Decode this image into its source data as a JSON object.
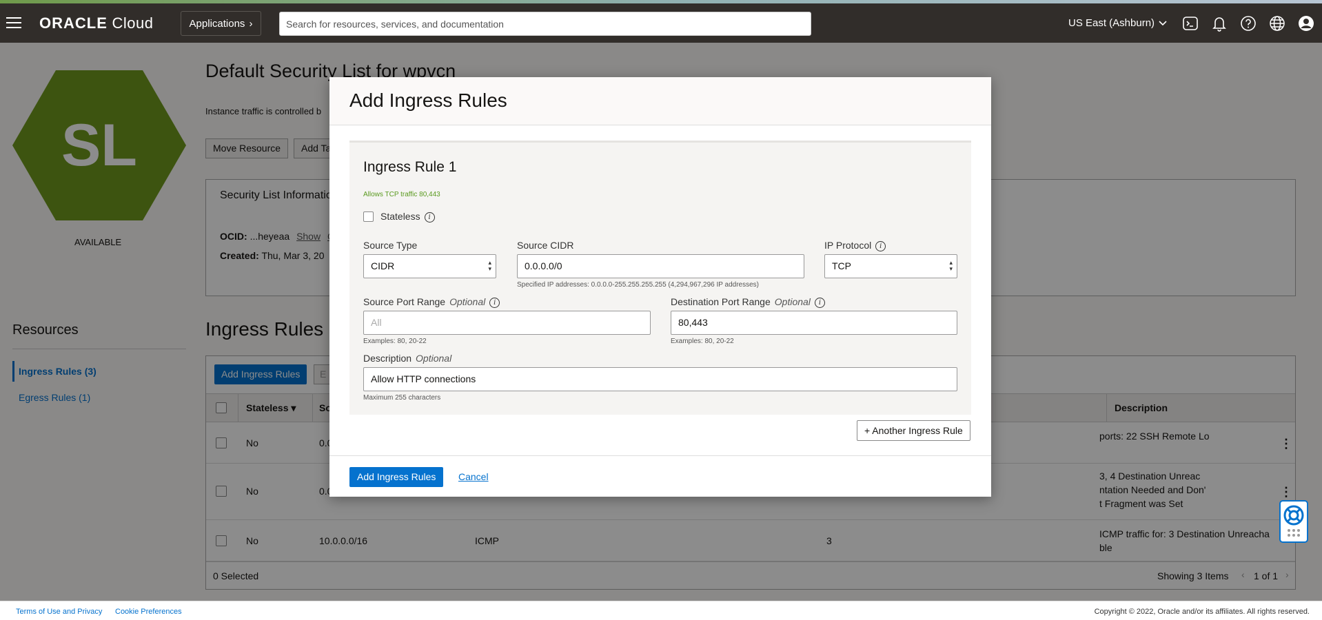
{
  "header": {
    "brand_bold": "ORACLE",
    "brand_rest": " Cloud",
    "applications_label": "Applications",
    "search_placeholder": "Search for resources, services, and documentation",
    "region": "US East (Ashburn)"
  },
  "left_panel": {
    "badge_text": "SL",
    "status": "AVAILABLE",
    "resources_heading": "Resources",
    "items": [
      {
        "label": "Ingress Rules (3)"
      },
      {
        "label": "Egress Rules (1)"
      }
    ]
  },
  "page": {
    "title": "Default Security List for wpvcn",
    "subtitle": "Instance traffic is controlled b",
    "buttons": {
      "move": "Move Resource",
      "add_tags": "Add Ta"
    },
    "info": {
      "title": "Security List Informatio",
      "ocid_label": "OCID:",
      "ocid_value": "...heyeaa",
      "show": "Show",
      "copy": "C",
      "created_label": "Created:",
      "created_value": "Thu, Mar 3, 20"
    },
    "ingress_heading": "Ingress Rules",
    "table": {
      "add_button": "Add Ingress Rules",
      "edit_button": "E",
      "columns": {
        "stateless": "Stateless",
        "source": "So",
        "description": "Description"
      },
      "rows": [
        {
          "stateless": "No",
          "source": "0.0",
          "protocol": "",
          "type": "",
          "description": "ports: 22 SSH Remote Lo"
        },
        {
          "stateless": "No",
          "source": "0.0",
          "protocol": "",
          "type": "",
          "description_1": "3, 4 Destination Unreac",
          "description_2": "ntation Needed and Don'",
          "description_3": "t Fragment was Set"
        },
        {
          "stateless": "No",
          "source": "10.0.0.0/16",
          "protocol": "ICMP",
          "type": "3",
          "description_1": "ICMP traffic for: 3 Destination Unreacha",
          "description_2": "ble"
        }
      ],
      "selected": "0 Selected",
      "showing": "Showing 3 Items",
      "pagination": "1 of 1"
    }
  },
  "footer": {
    "terms": "Terms of Use and Privacy",
    "cookies": "Cookie Preferences",
    "copyright": "Copyright © 2022, Oracle and/or its affiliates. All rights reserved."
  },
  "modal": {
    "title": "Add Ingress Rules",
    "rule_title": "Ingress Rule 1",
    "summary": "Allows TCP traffic 80,443",
    "stateless_label": "Stateless",
    "source_type_label": "Source Type",
    "source_type_value": "CIDR",
    "source_cidr_label": "Source CIDR",
    "source_cidr_value": "0.0.0.0/0",
    "source_cidr_hint": "Specified IP addresses: 0.0.0.0-255.255.255.255 (4,294,967,296 IP addresses)",
    "ip_protocol_label": "IP Protocol",
    "ip_protocol_value": "TCP",
    "source_port_label": "Source Port Range",
    "optional": "Optional",
    "source_port_placeholder": "All",
    "port_hint": "Examples: 80, 20-22",
    "dest_port_label": "Destination Port Range",
    "dest_port_value": "80,443",
    "description_label": "Description",
    "description_value": "Allow HTTP connections",
    "description_hint": "Maximum 255 characters",
    "another_rule": "+ Another Ingress Rule",
    "submit": "Add Ingress Rules",
    "cancel": "Cancel"
  },
  "colors": {
    "accent": "#0572ce",
    "header_bg": "#312d2a",
    "badge": "#6f9a1e",
    "summary": "#5a9a1f"
  }
}
